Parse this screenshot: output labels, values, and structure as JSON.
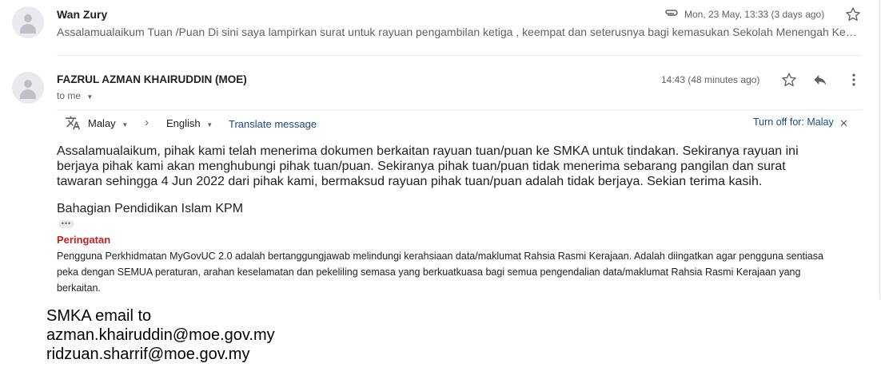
{
  "thread": [
    {
      "sender": "Wan Zury",
      "snippet": "Assalamualaikum Tuan /Puan Di sini saya lampirkan surat untuk rayuan pengambilan ketiga , keempat dan seterusnya bagi kemasukan Sekolah Menengah Kebangsaan Agama",
      "date": "Mon, 23 May, 13:33 (3 days ago)"
    },
    {
      "sender": "FAZRUL AZMAN KHAIRUDDIN (MOE)",
      "to": "to me",
      "time": "14:43 (48 minutes ago)",
      "translate": {
        "source_lang": "Malay",
        "target_lang": "English",
        "action": "Translate message",
        "turn_off": "Turn off for: Malay"
      },
      "body": "Assalamualaikum, pihak kami telah menerima dokumen berkaitan rayuan tuan/puan ke SMKA untuk tindakan. Sekiranya rayuan ini berjaya pihak kami akan menghubungi pihak tuan/puan. Sekiranya pihak tuan/puan tidak menerima sebarang pangilan dan surat tawaran sehingga 4 Jun 2022 dari pihak kami, bermaksud rayuan pihak tuan/puan adalah tidak berjaya. Sekian terima kasih.",
      "signature": "Bahagian Pendidikan Islam KPM",
      "warning_title": "Peringatan",
      "warning_text": "Pengguna Perkhidmatan MyGovUC 2.0 adalah bertanggungjawab melindungi kerahsiaan data/maklumat Rahsia Rasmi Kerajaan. Adalah diingatkan agar pengguna sentiasa peka dengan SEMUA peraturan, arahan keselamatan dan pekeliling semasa yang berkuatkuasa bagi semua pengendalian data/maklumat Rahsia Rasmi Kerajaan yang berkaitan."
    }
  ],
  "caption": {
    "line1": "SMKA email to",
    "line2": "azman.khairuddin@moe.gov.my",
    "line3": "ridzuan.sharrif@moe.gov.my"
  },
  "icons": {
    "attachment": "paperclip-icon",
    "star": "star-icon",
    "reply": "reply-icon",
    "more": "more-vertical-icon",
    "translate": "translate-icon",
    "close": "close-icon"
  }
}
